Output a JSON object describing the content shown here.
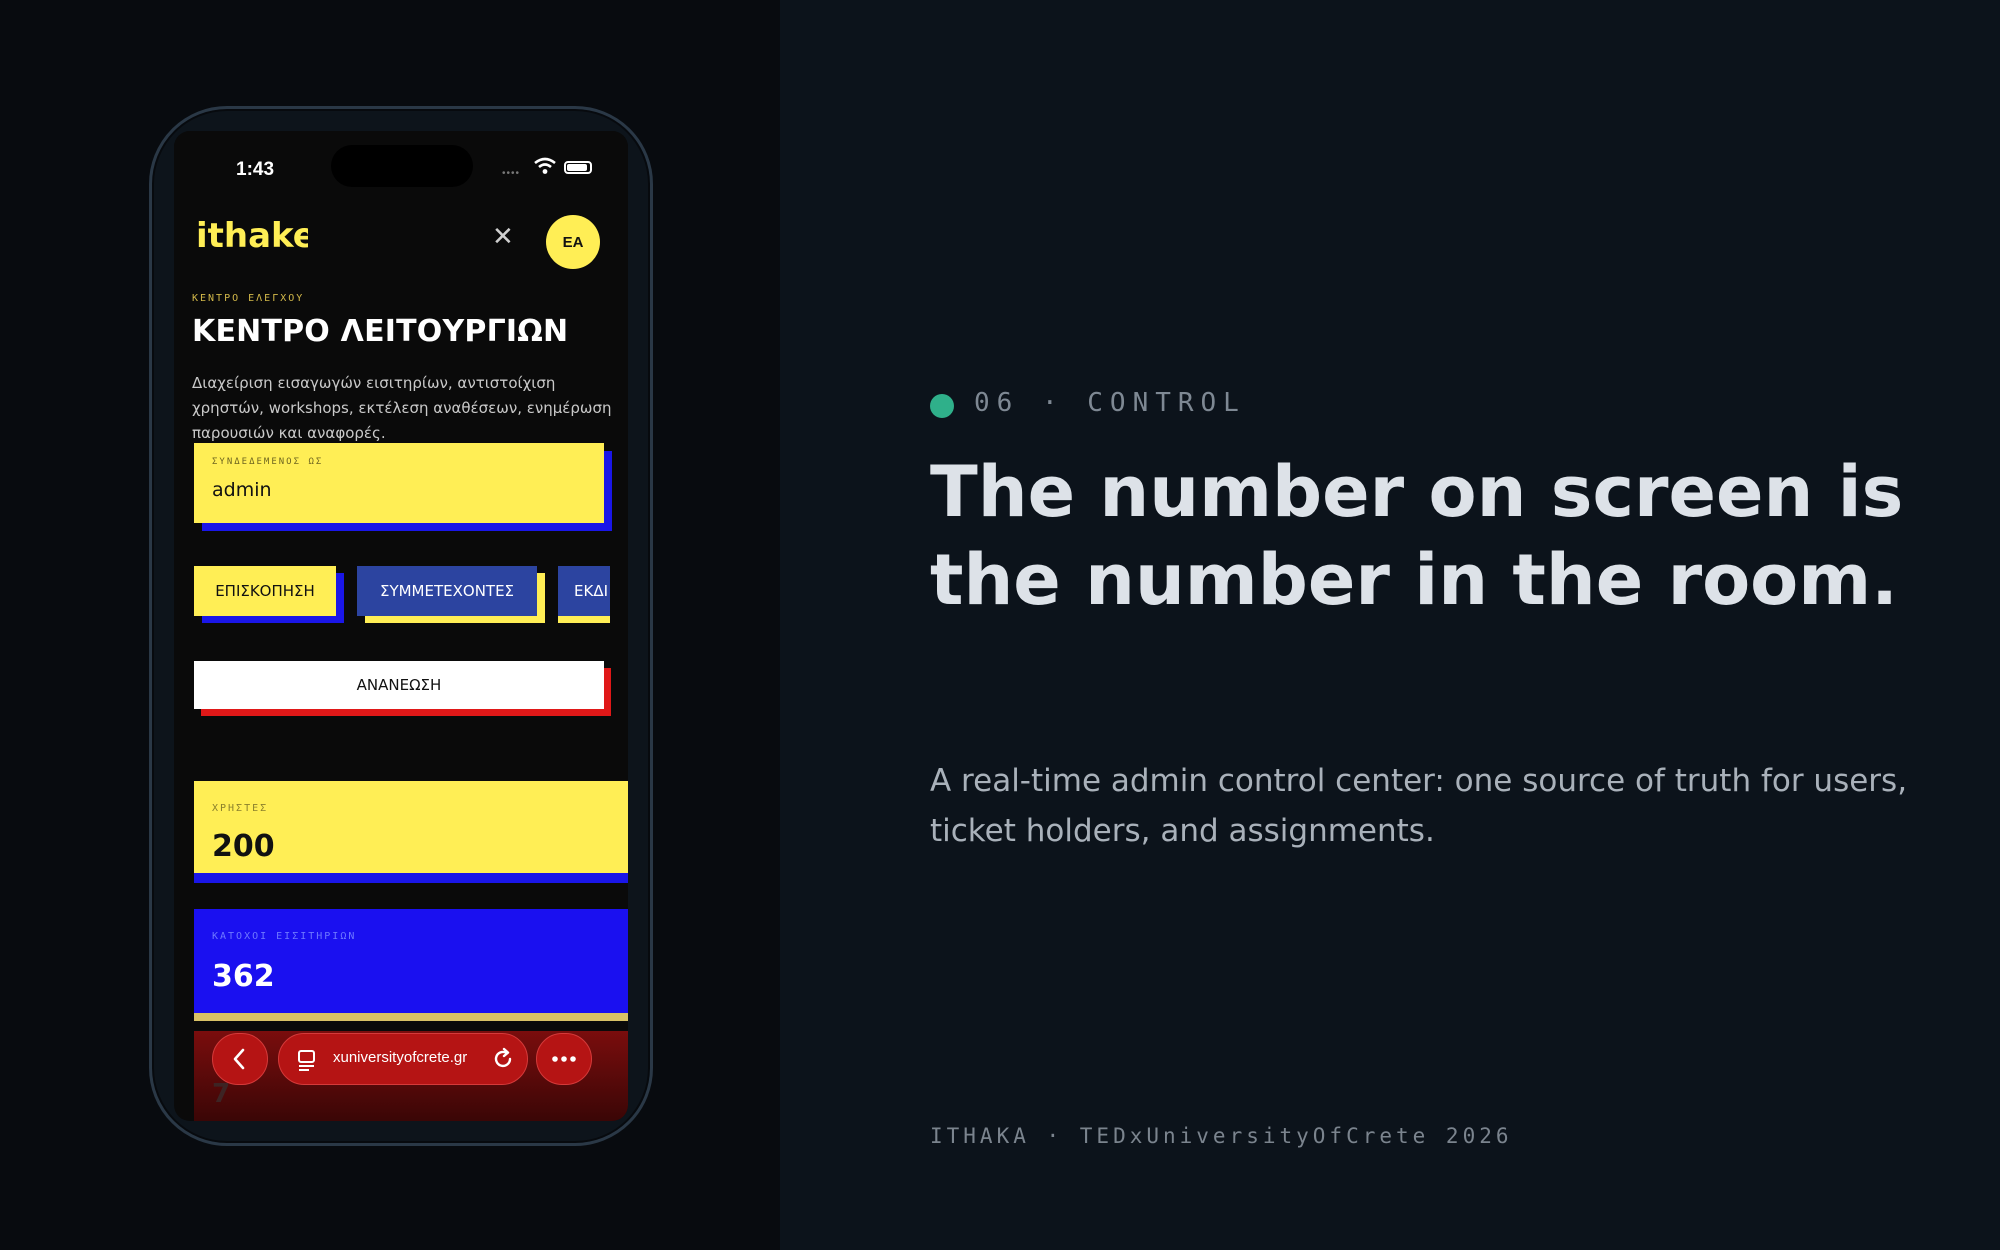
{
  "colors": {
    "accent_yellow": "#ffee55",
    "accent_blue": "#1a16e8",
    "accent_red": "#e01818",
    "status_dot": "#2fb08a"
  },
  "phone": {
    "status_time": "1:43",
    "logo_text": "ithake",
    "avatar_initials": "EA",
    "kicker": "ΚΕΝΤΡΟ ΕΛΕΓΧΟΥ",
    "title": "ΚΕΝΤΡΟ ΛΕΙΤΟΥΡΓΙΩΝ",
    "description": "Διαχείριση εισαγωγών εισιτηρίων, αντιστοίχιση χρηστών, workshops, εκτέλεση αναθέσεων, ενημέρωση παρουσιών και αναφορές.",
    "login": {
      "label": "ΣΥΝΔΕΔΕΜΕΝΟΣ ΩΣ",
      "value": "admin"
    },
    "tabs": [
      {
        "label": "ΕΠΙΣΚΟΠΗΣΗ"
      },
      {
        "label": "ΣΥΜΜΕΤΕΧΟΝΤΕΣ"
      },
      {
        "label": "ΕΚΔΙ"
      }
    ],
    "refresh_label": "ΑΝΑΝΕΩΣΗ",
    "stats": [
      {
        "label": "ΧΡΗΣΤΕΣ",
        "value": "200"
      },
      {
        "label": "ΚΑΤΟΧΟΙ ΕΙΣΙΤΗΡΙΩΝ",
        "value": "362"
      },
      {
        "label": "",
        "value": "7"
      }
    ],
    "browser": {
      "url": "xuniversityofcrete.gr"
    }
  },
  "slide": {
    "section_tag": "06 · CONTROL",
    "headline": "The number on screen is the number in the room.",
    "subtext": "A real-time admin control center: one source of truth for users, ticket holders, and assignments.",
    "footer": "ITHAKA · TEDxUniversityOfCrete 2026"
  }
}
